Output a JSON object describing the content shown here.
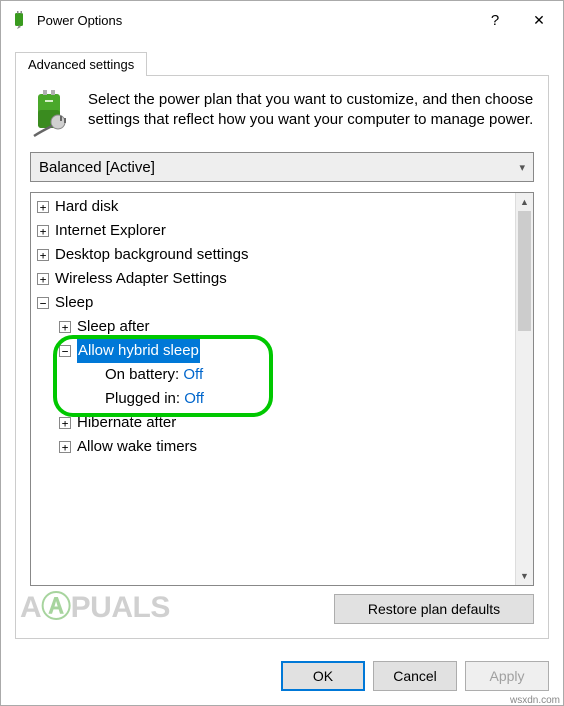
{
  "window": {
    "title": "Power Options",
    "help_symbol": "?",
    "close_symbol": "✕"
  },
  "tab": {
    "label": "Advanced settings"
  },
  "intro": "Select the power plan that you want to customize, and then choose settings that reflect how you want your computer to manage power.",
  "plan_selector": {
    "value": "Balanced [Active]"
  },
  "tree": {
    "hard_disk": "Hard disk",
    "ie": "Internet Explorer",
    "desktop_bg": "Desktop background settings",
    "wireless": "Wireless Adapter Settings",
    "sleep": "Sleep",
    "sleep_after": "Sleep after",
    "allow_hybrid": "Allow hybrid sleep",
    "on_battery_label": "On battery:",
    "on_battery_value": "Off",
    "plugged_in_label": "Plugged in:",
    "plugged_in_value": "Off",
    "hibernate_after": "Hibernate after",
    "allow_wake": "Allow wake timers"
  },
  "buttons": {
    "restore": "Restore plan defaults",
    "ok": "OK",
    "cancel": "Cancel",
    "apply": "Apply"
  },
  "watermark": {
    "pre": "A",
    "green": "Ⓐ",
    "post": "PUALS"
  },
  "attribution": "wsxdn.com"
}
